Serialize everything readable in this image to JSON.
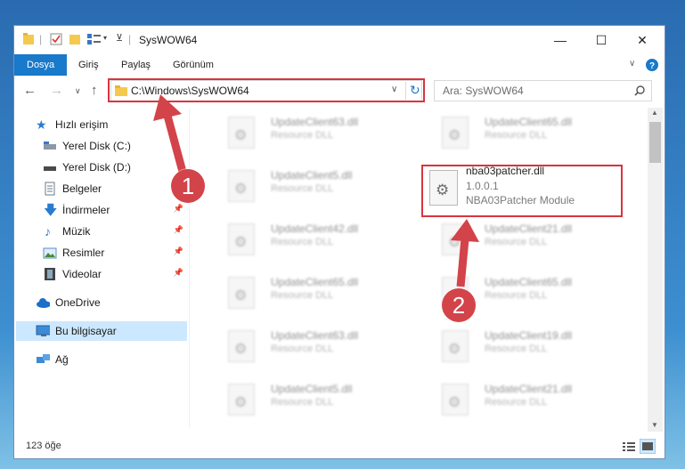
{
  "window": {
    "title": "SysWOW64"
  },
  "ribbon": {
    "tabs": [
      "Dosya",
      "Giriş",
      "Paylaş",
      "Görünüm"
    ]
  },
  "address": {
    "path": "C:\\Windows\\SysWOW64"
  },
  "search": {
    "placeholder": "Ara: SysWOW64"
  },
  "nav": {
    "items": [
      {
        "label": "Hızlı erişim"
      },
      {
        "label": "Yerel Disk (C:)"
      },
      {
        "label": "Yerel Disk (D:)"
      },
      {
        "label": "Belgeler"
      },
      {
        "label": "İndirmeler"
      },
      {
        "label": "Müzik"
      },
      {
        "label": "Resimler"
      },
      {
        "label": "Videolar"
      },
      {
        "label": "OneDrive"
      },
      {
        "label": "Bu bilgisayar"
      },
      {
        "label": "Ağ"
      }
    ]
  },
  "files": {
    "left": [
      {
        "name": "UpdateClient63.dll",
        "type": "Resource DLL"
      },
      {
        "name": "UpdateClient5.dll",
        "type": "Resource DLL"
      },
      {
        "name": "UpdateClient42.dll",
        "type": "Resource DLL"
      },
      {
        "name": "UpdateClient65.dll",
        "type": "Resource DLL"
      },
      {
        "name": "UpdateClient63.dll",
        "type": "Resource DLL"
      },
      {
        "name": "UpdateClient5.dll",
        "type": "Resource DLL"
      }
    ],
    "right": [
      {
        "name": "UpdateClient65.dll",
        "type": "Resource DLL"
      },
      {
        "name": "UpdateClient21.dll",
        "type": "Resource DLL"
      },
      {
        "name": "UpdateClient65.dll",
        "type": "Resource DLL"
      },
      {
        "name": "UpdateClient19.dll",
        "type": "Resource DLL"
      },
      {
        "name": "UpdateClient21.dll",
        "type": "Resource DLL"
      }
    ],
    "highlighted": {
      "name": "nba03patcher.dll",
      "version": "1.0.0.1",
      "description": "NBA03Patcher Module"
    }
  },
  "status": {
    "count": "123 öğe"
  },
  "annotations": {
    "step1": "1",
    "step2": "2"
  },
  "colors": {
    "accent": "#1979ca",
    "highlight": "#d9343f"
  }
}
